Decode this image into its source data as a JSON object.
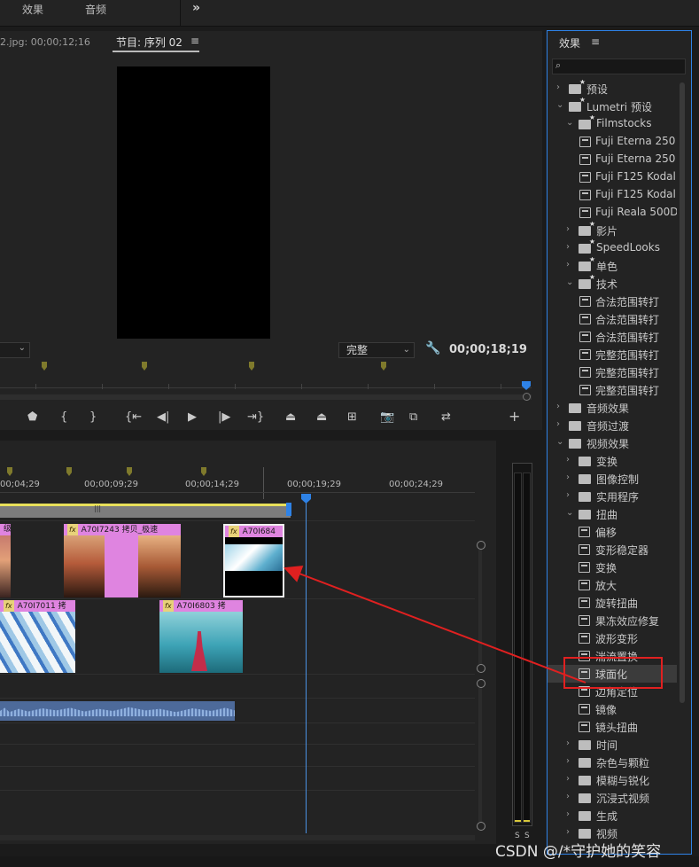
{
  "workspace_tabs": [
    "效果",
    "音频"
  ],
  "more_glyph": "»",
  "monitor": {
    "source_tab": "2.jpg: 00;00;12;16",
    "program_tab": "节目: 序列 02",
    "menu_glyph": "≡",
    "fit_label": "完整",
    "timecode": "00;00;18;19"
  },
  "timeline": {
    "timecodes": [
      "00;04;29",
      "00;00;09;29",
      "00;00;14;29",
      "00;00;19;29",
      "00;00;24;29"
    ],
    "clips": {
      "v2_a": "级",
      "v2_b": "A70I7243 拷贝_极速",
      "v2_c": "A70I684",
      "v1_a": "A70I7011 拷",
      "v1_b": "A70I6803 拷"
    },
    "fx_badge": "fx"
  },
  "meter": {
    "solo_left": "S",
    "solo_right": "S"
  },
  "effects_panel": {
    "title": "效果",
    "menu_glyph": "≡",
    "search_glyph": "⌕",
    "rows": [
      {
        "label": "预设",
        "indent": 0,
        "chev": "›",
        "icon": "folder-star"
      },
      {
        "label": "Lumetri 预设",
        "indent": 0,
        "chev": "⌄",
        "icon": "folder-star"
      },
      {
        "label": "Filmstocks",
        "indent": 1,
        "chev": "⌄",
        "icon": "folder-star"
      },
      {
        "label": "Fuji Eterna 250",
        "indent": 2,
        "chev": "",
        "icon": "preset"
      },
      {
        "label": "Fuji Eterna 250",
        "indent": 2,
        "chev": "",
        "icon": "preset"
      },
      {
        "label": "Fuji F125 Kodal",
        "indent": 2,
        "chev": "",
        "icon": "preset"
      },
      {
        "label": "Fuji F125 Kodal",
        "indent": 2,
        "chev": "",
        "icon": "preset"
      },
      {
        "label": "Fuji Reala 500D",
        "indent": 2,
        "chev": "",
        "icon": "preset"
      },
      {
        "label": "影片",
        "indent": 1,
        "chev": "›",
        "icon": "folder-star"
      },
      {
        "label": "SpeedLooks",
        "indent": 1,
        "chev": "›",
        "icon": "folder-star"
      },
      {
        "label": "单色",
        "indent": 1,
        "chev": "›",
        "icon": "folder-star"
      },
      {
        "label": "技术",
        "indent": 1,
        "chev": "⌄",
        "icon": "folder-star"
      },
      {
        "label": "合法范围转打",
        "indent": 2,
        "chev": "",
        "icon": "preset"
      },
      {
        "label": "合法范围转打",
        "indent": 2,
        "chev": "",
        "icon": "preset"
      },
      {
        "label": "合法范围转打",
        "indent": 2,
        "chev": "",
        "icon": "preset"
      },
      {
        "label": "完整范围转打",
        "indent": 2,
        "chev": "",
        "icon": "preset"
      },
      {
        "label": "完整范围转打",
        "indent": 2,
        "chev": "",
        "icon": "preset"
      },
      {
        "label": "完整范围转打",
        "indent": 2,
        "chev": "",
        "icon": "preset"
      },
      {
        "label": "音频效果",
        "indent": 0,
        "chev": "›",
        "icon": "folder"
      },
      {
        "label": "音频过渡",
        "indent": 0,
        "chev": "›",
        "icon": "folder"
      },
      {
        "label": "视频效果",
        "indent": 0,
        "chev": "⌄",
        "icon": "folder"
      },
      {
        "label": "变换",
        "indent": 1,
        "chev": "›",
        "icon": "folder"
      },
      {
        "label": "图像控制",
        "indent": 1,
        "chev": "›",
        "icon": "folder"
      },
      {
        "label": "实用程序",
        "indent": 1,
        "chev": "›",
        "icon": "folder"
      },
      {
        "label": "扭曲",
        "indent": 1,
        "chev": "⌄",
        "icon": "folder"
      },
      {
        "label": "偏移",
        "indent": 2,
        "chev": "",
        "icon": "effect"
      },
      {
        "label": "变形稳定器",
        "indent": 2,
        "chev": "",
        "icon": "effect"
      },
      {
        "label": "变换",
        "indent": 2,
        "chev": "",
        "icon": "effect"
      },
      {
        "label": "放大",
        "indent": 2,
        "chev": "",
        "icon": "effect"
      },
      {
        "label": "旋转扭曲",
        "indent": 2,
        "chev": "",
        "icon": "effect"
      },
      {
        "label": "果冻效应修复",
        "indent": 2,
        "chev": "",
        "icon": "effect"
      },
      {
        "label": "波形变形",
        "indent": 2,
        "chev": "",
        "icon": "effect"
      },
      {
        "label": "湍流置换",
        "indent": 2,
        "chev": "",
        "icon": "effect"
      },
      {
        "label": "球面化",
        "indent": 2,
        "chev": "",
        "icon": "effect",
        "highlight": true
      },
      {
        "label": "边角定位",
        "indent": 2,
        "chev": "",
        "icon": "effect"
      },
      {
        "label": "镜像",
        "indent": 2,
        "chev": "",
        "icon": "effect"
      },
      {
        "label": "镜头扭曲",
        "indent": 2,
        "chev": "",
        "icon": "effect"
      },
      {
        "label": "时间",
        "indent": 1,
        "chev": "›",
        "icon": "folder"
      },
      {
        "label": "杂色与颗粒",
        "indent": 1,
        "chev": "›",
        "icon": "folder"
      },
      {
        "label": "模糊与锐化",
        "indent": 1,
        "chev": "›",
        "icon": "folder"
      },
      {
        "label": "沉浸式视频",
        "indent": 1,
        "chev": "›",
        "icon": "folder"
      },
      {
        "label": "生成",
        "indent": 1,
        "chev": "›",
        "icon": "folder"
      },
      {
        "label": "视频",
        "indent": 1,
        "chev": "›",
        "icon": "folder"
      }
    ]
  },
  "watermark": "CSDN @/*守护她的笑容",
  "colors": {
    "accent": "#2e82e6",
    "annotation": "#e02020",
    "clip_label": "#df84e0"
  }
}
